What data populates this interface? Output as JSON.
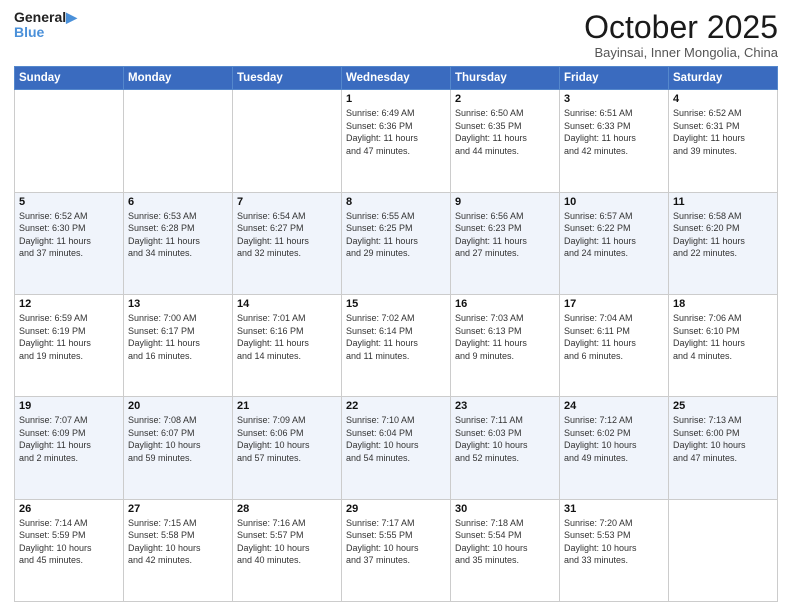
{
  "logo": {
    "line1": "General",
    "line2": "Blue"
  },
  "title": "October 2025",
  "location": "Bayinsai, Inner Mongolia, China",
  "weekdays": [
    "Sunday",
    "Monday",
    "Tuesday",
    "Wednesday",
    "Thursday",
    "Friday",
    "Saturday"
  ],
  "weeks": [
    [
      {
        "day": "",
        "info": ""
      },
      {
        "day": "",
        "info": ""
      },
      {
        "day": "",
        "info": ""
      },
      {
        "day": "1",
        "info": "Sunrise: 6:49 AM\nSunset: 6:36 PM\nDaylight: 11 hours\nand 47 minutes."
      },
      {
        "day": "2",
        "info": "Sunrise: 6:50 AM\nSunset: 6:35 PM\nDaylight: 11 hours\nand 44 minutes."
      },
      {
        "day": "3",
        "info": "Sunrise: 6:51 AM\nSunset: 6:33 PM\nDaylight: 11 hours\nand 42 minutes."
      },
      {
        "day": "4",
        "info": "Sunrise: 6:52 AM\nSunset: 6:31 PM\nDaylight: 11 hours\nand 39 minutes."
      }
    ],
    [
      {
        "day": "5",
        "info": "Sunrise: 6:52 AM\nSunset: 6:30 PM\nDaylight: 11 hours\nand 37 minutes."
      },
      {
        "day": "6",
        "info": "Sunrise: 6:53 AM\nSunset: 6:28 PM\nDaylight: 11 hours\nand 34 minutes."
      },
      {
        "day": "7",
        "info": "Sunrise: 6:54 AM\nSunset: 6:27 PM\nDaylight: 11 hours\nand 32 minutes."
      },
      {
        "day": "8",
        "info": "Sunrise: 6:55 AM\nSunset: 6:25 PM\nDaylight: 11 hours\nand 29 minutes."
      },
      {
        "day": "9",
        "info": "Sunrise: 6:56 AM\nSunset: 6:23 PM\nDaylight: 11 hours\nand 27 minutes."
      },
      {
        "day": "10",
        "info": "Sunrise: 6:57 AM\nSunset: 6:22 PM\nDaylight: 11 hours\nand 24 minutes."
      },
      {
        "day": "11",
        "info": "Sunrise: 6:58 AM\nSunset: 6:20 PM\nDaylight: 11 hours\nand 22 minutes."
      }
    ],
    [
      {
        "day": "12",
        "info": "Sunrise: 6:59 AM\nSunset: 6:19 PM\nDaylight: 11 hours\nand 19 minutes."
      },
      {
        "day": "13",
        "info": "Sunrise: 7:00 AM\nSunset: 6:17 PM\nDaylight: 11 hours\nand 16 minutes."
      },
      {
        "day": "14",
        "info": "Sunrise: 7:01 AM\nSunset: 6:16 PM\nDaylight: 11 hours\nand 14 minutes."
      },
      {
        "day": "15",
        "info": "Sunrise: 7:02 AM\nSunset: 6:14 PM\nDaylight: 11 hours\nand 11 minutes."
      },
      {
        "day": "16",
        "info": "Sunrise: 7:03 AM\nSunset: 6:13 PM\nDaylight: 11 hours\nand 9 minutes."
      },
      {
        "day": "17",
        "info": "Sunrise: 7:04 AM\nSunset: 6:11 PM\nDaylight: 11 hours\nand 6 minutes."
      },
      {
        "day": "18",
        "info": "Sunrise: 7:06 AM\nSunset: 6:10 PM\nDaylight: 11 hours\nand 4 minutes."
      }
    ],
    [
      {
        "day": "19",
        "info": "Sunrise: 7:07 AM\nSunset: 6:09 PM\nDaylight: 11 hours\nand 2 minutes."
      },
      {
        "day": "20",
        "info": "Sunrise: 7:08 AM\nSunset: 6:07 PM\nDaylight: 10 hours\nand 59 minutes."
      },
      {
        "day": "21",
        "info": "Sunrise: 7:09 AM\nSunset: 6:06 PM\nDaylight: 10 hours\nand 57 minutes."
      },
      {
        "day": "22",
        "info": "Sunrise: 7:10 AM\nSunset: 6:04 PM\nDaylight: 10 hours\nand 54 minutes."
      },
      {
        "day": "23",
        "info": "Sunrise: 7:11 AM\nSunset: 6:03 PM\nDaylight: 10 hours\nand 52 minutes."
      },
      {
        "day": "24",
        "info": "Sunrise: 7:12 AM\nSunset: 6:02 PM\nDaylight: 10 hours\nand 49 minutes."
      },
      {
        "day": "25",
        "info": "Sunrise: 7:13 AM\nSunset: 6:00 PM\nDaylight: 10 hours\nand 47 minutes."
      }
    ],
    [
      {
        "day": "26",
        "info": "Sunrise: 7:14 AM\nSunset: 5:59 PM\nDaylight: 10 hours\nand 45 minutes."
      },
      {
        "day": "27",
        "info": "Sunrise: 7:15 AM\nSunset: 5:58 PM\nDaylight: 10 hours\nand 42 minutes."
      },
      {
        "day": "28",
        "info": "Sunrise: 7:16 AM\nSunset: 5:57 PM\nDaylight: 10 hours\nand 40 minutes."
      },
      {
        "day": "29",
        "info": "Sunrise: 7:17 AM\nSunset: 5:55 PM\nDaylight: 10 hours\nand 37 minutes."
      },
      {
        "day": "30",
        "info": "Sunrise: 7:18 AM\nSunset: 5:54 PM\nDaylight: 10 hours\nand 35 minutes."
      },
      {
        "day": "31",
        "info": "Sunrise: 7:20 AM\nSunset: 5:53 PM\nDaylight: 10 hours\nand 33 minutes."
      },
      {
        "day": "",
        "info": ""
      }
    ]
  ]
}
